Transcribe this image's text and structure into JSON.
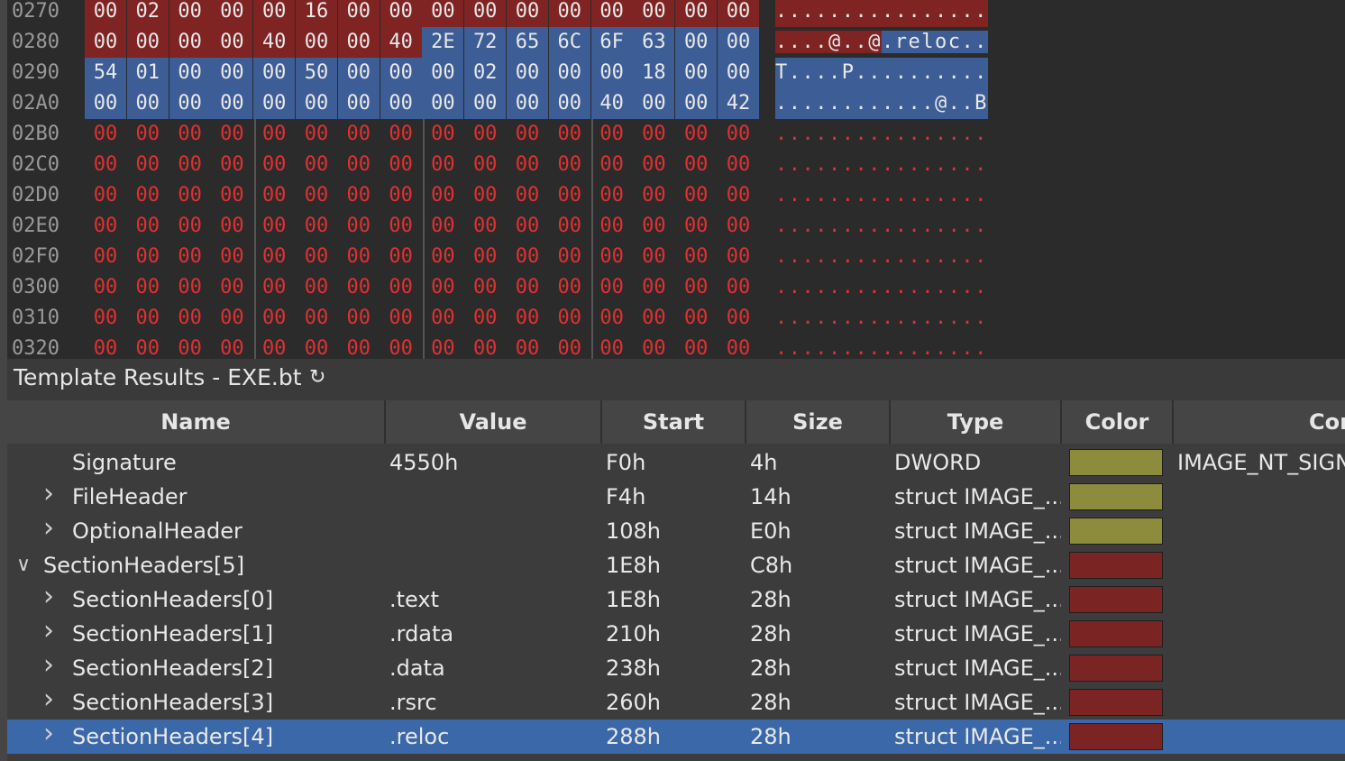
{
  "hex": {
    "rows": [
      {
        "addr": "0270",
        "bytes": [
          "00",
          "02",
          "00",
          "00",
          "00",
          "16",
          "00",
          "00",
          "00",
          "00",
          "00",
          "00",
          "00",
          "00",
          "00",
          "00"
        ],
        "ascii": "................",
        "kind": "red-bg"
      },
      {
        "addr": "0280",
        "bytes": [
          "00",
          "00",
          "00",
          "00",
          "40",
          "00",
          "00",
          "40",
          "2E",
          "72",
          "65",
          "6C",
          "6F",
          "63",
          "00",
          "00"
        ],
        "ascii": "....@..@.reloc..",
        "kind": "split"
      },
      {
        "addr": "0290",
        "bytes": [
          "54",
          "01",
          "00",
          "00",
          "00",
          "50",
          "00",
          "00",
          "00",
          "02",
          "00",
          "00",
          "00",
          "18",
          "00",
          "00"
        ],
        "ascii": "T....P..........",
        "kind": "blue-bg"
      },
      {
        "addr": "02A0",
        "bytes": [
          "00",
          "00",
          "00",
          "00",
          "00",
          "00",
          "00",
          "00",
          "00",
          "00",
          "00",
          "00",
          "40",
          "00",
          "00",
          "42"
        ],
        "ascii": "............@..B",
        "kind": "blue-bg"
      },
      {
        "addr": "02B0",
        "bytes": [
          "00",
          "00",
          "00",
          "00",
          "00",
          "00",
          "00",
          "00",
          "00",
          "00",
          "00",
          "00",
          "00",
          "00",
          "00",
          "00"
        ],
        "ascii": "................",
        "kind": "red-text"
      },
      {
        "addr": "02C0",
        "bytes": [
          "00",
          "00",
          "00",
          "00",
          "00",
          "00",
          "00",
          "00",
          "00",
          "00",
          "00",
          "00",
          "00",
          "00",
          "00",
          "00"
        ],
        "ascii": "................",
        "kind": "red-text"
      },
      {
        "addr": "02D0",
        "bytes": [
          "00",
          "00",
          "00",
          "00",
          "00",
          "00",
          "00",
          "00",
          "00",
          "00",
          "00",
          "00",
          "00",
          "00",
          "00",
          "00"
        ],
        "ascii": "................",
        "kind": "red-text"
      },
      {
        "addr": "02E0",
        "bytes": [
          "00",
          "00",
          "00",
          "00",
          "00",
          "00",
          "00",
          "00",
          "00",
          "00",
          "00",
          "00",
          "00",
          "00",
          "00",
          "00"
        ],
        "ascii": "................",
        "kind": "red-text"
      },
      {
        "addr": "02F0",
        "bytes": [
          "00",
          "00",
          "00",
          "00",
          "00",
          "00",
          "00",
          "00",
          "00",
          "00",
          "00",
          "00",
          "00",
          "00",
          "00",
          "00"
        ],
        "ascii": "................",
        "kind": "red-text"
      },
      {
        "addr": "0300",
        "bytes": [
          "00",
          "00",
          "00",
          "00",
          "00",
          "00",
          "00",
          "00",
          "00",
          "00",
          "00",
          "00",
          "00",
          "00",
          "00",
          "00"
        ],
        "ascii": "................",
        "kind": "red-text"
      },
      {
        "addr": "0310",
        "bytes": [
          "00",
          "00",
          "00",
          "00",
          "00",
          "00",
          "00",
          "00",
          "00",
          "00",
          "00",
          "00",
          "00",
          "00",
          "00",
          "00"
        ],
        "ascii": "................",
        "kind": "red-text"
      },
      {
        "addr": "0320",
        "bytes": [
          "00",
          "00",
          "00",
          "00",
          "00",
          "00",
          "00",
          "00",
          "00",
          "00",
          "00",
          "00",
          "00",
          "00",
          "00",
          "00"
        ],
        "ascii": "................",
        "kind": "red-text"
      }
    ]
  },
  "panel": {
    "title": "Template Results - EXE.bt",
    "refresh_icon": "refresh-icon"
  },
  "table": {
    "columns": [
      "Name",
      "Value",
      "Start",
      "Size",
      "Type",
      "Color",
      "Cor"
    ],
    "rows": [
      {
        "name": "Signature",
        "value": "4550h",
        "start": "F0h",
        "size": "4h",
        "type": "DWORD",
        "color": "#8c8c3c",
        "comment": "IMAGE_NT_SIGN",
        "indent": 2,
        "expander": "none"
      },
      {
        "name": "FileHeader",
        "value": "",
        "start": "F4h",
        "size": "14h",
        "type": "struct IMAGE_...",
        "color": "#8c8c3c",
        "comment": "",
        "indent": 2,
        "expander": "collapsed"
      },
      {
        "name": "OptionalHeader",
        "value": "",
        "start": "108h",
        "size": "E0h",
        "type": "struct IMAGE_...",
        "color": "#8c8c3c",
        "comment": "",
        "indent": 2,
        "expander": "collapsed"
      },
      {
        "name": "SectionHeaders[5]",
        "value": "",
        "start": "1E8h",
        "size": "C8h",
        "type": "struct IMAGE_...",
        "color": "#7a2424",
        "comment": "",
        "indent": 1,
        "expander": "expanded"
      },
      {
        "name": "SectionHeaders[0]",
        "value": ".text",
        "start": "1E8h",
        "size": "28h",
        "type": "struct IMAGE_...",
        "color": "#7a2424",
        "comment": "",
        "indent": 2,
        "expander": "collapsed"
      },
      {
        "name": "SectionHeaders[1]",
        "value": ".rdata",
        "start": "210h",
        "size": "28h",
        "type": "struct IMAGE_...",
        "color": "#7a2424",
        "comment": "",
        "indent": 2,
        "expander": "collapsed"
      },
      {
        "name": "SectionHeaders[2]",
        "value": ".data",
        "start": "238h",
        "size": "28h",
        "type": "struct IMAGE_...",
        "color": "#7a2424",
        "comment": "",
        "indent": 2,
        "expander": "collapsed"
      },
      {
        "name": "SectionHeaders[3]",
        "value": ".rsrc",
        "start": "260h",
        "size": "28h",
        "type": "struct IMAGE_...",
        "color": "#7a2424",
        "comment": "",
        "indent": 2,
        "expander": "collapsed"
      },
      {
        "name": "SectionHeaders[4]",
        "value": ".reloc",
        "start": "288h",
        "size": "28h",
        "type": "struct IMAGE_...",
        "color": "#7a2424",
        "comment": "",
        "indent": 2,
        "expander": "collapsed",
        "selected": true
      }
    ]
  },
  "colors": {
    "red_bg": "#7f2323",
    "blue_bg": "#3d5d96",
    "red_text": "#e03131",
    "selection": "#3a68a8"
  }
}
